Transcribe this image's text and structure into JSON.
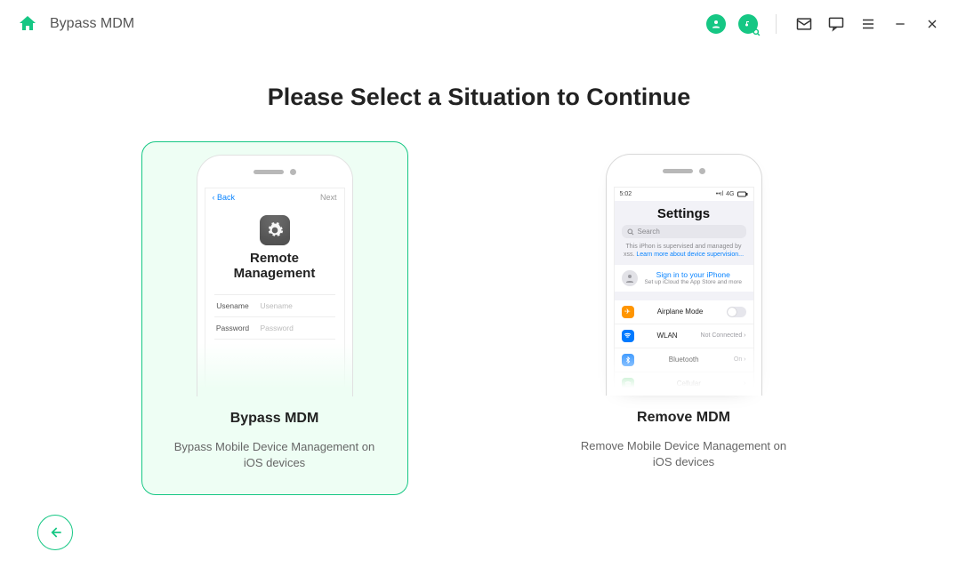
{
  "titlebar": {
    "title": "Bypass MDM"
  },
  "headline": "Please Select a Situation to Continue",
  "cards": {
    "bypass": {
      "title": "Bypass MDM",
      "subtitle": "Bypass Mobile Device Management on iOS devices",
      "phone": {
        "back": "Back",
        "next": "Next",
        "title_line1": "Remote",
        "title_line2": "Management",
        "username_label": "Usename",
        "username_placeholder": "Usename",
        "password_label": "Password",
        "password_placeholder": "Password"
      }
    },
    "remove": {
      "title": "Remove MDM",
      "subtitle": "Remove Mobile Device Management on iOS devices",
      "phone": {
        "time": "5:02",
        "status_right": "4G",
        "settings_title": "Settings",
        "search_placeholder": "Search",
        "supervision_note": "This iPhon is supervised and managed by xss.",
        "supervision_link": "Learn more about device supervision...",
        "signin_title": "Sign in to your iPhone",
        "signin_sub": "Set up iCloud the App Store and more",
        "rows": {
          "airplane": {
            "label": "Airplane Mode"
          },
          "wlan": {
            "label": "WLAN",
            "value": "Not Connected"
          },
          "bluetooth": {
            "label": "Bluetooth",
            "value": "On"
          },
          "cellular": {
            "label": "Cellular"
          }
        }
      }
    }
  }
}
